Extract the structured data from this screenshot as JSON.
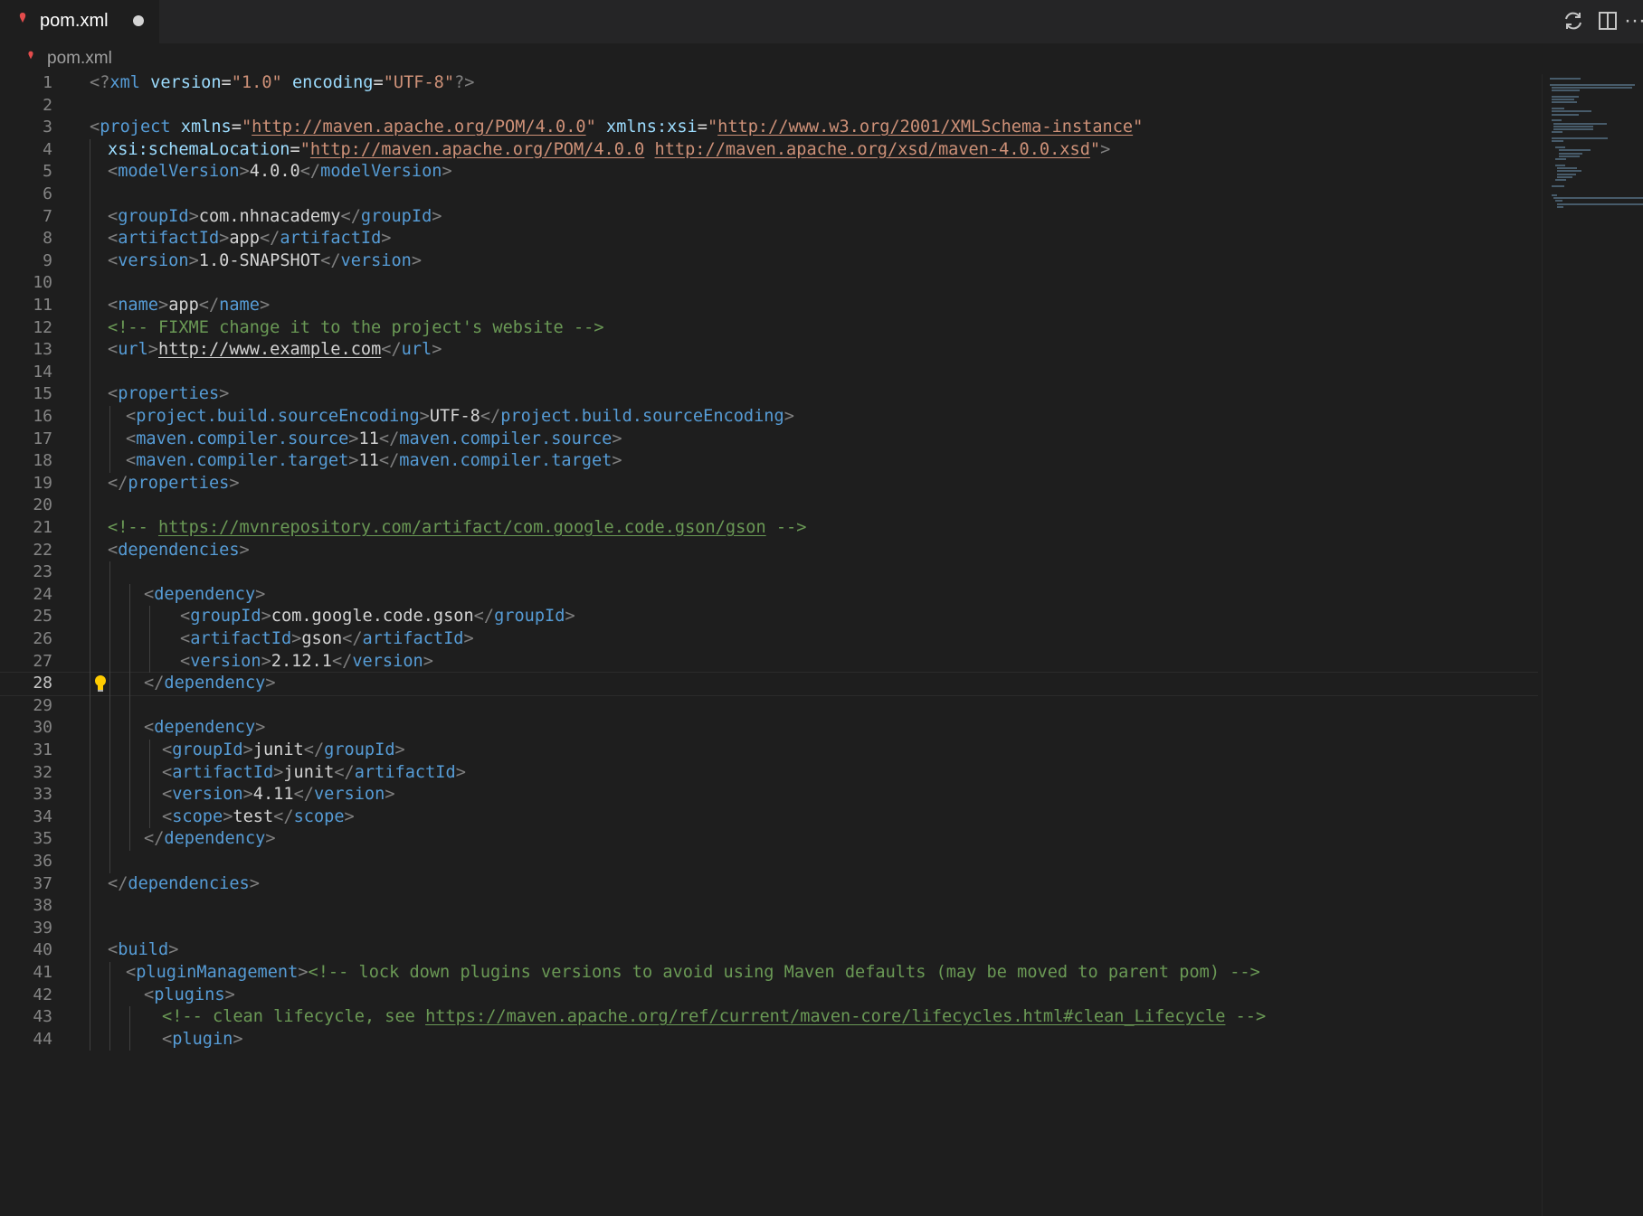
{
  "tab": {
    "title": "pom.xml",
    "dirty": true
  },
  "breadcrumb": {
    "label": "pom.xml"
  },
  "actions": [
    "sync-icon",
    "split-editor-icon",
    "more-actions-icon"
  ],
  "editor": {
    "active_line": 28,
    "line_numbers": [
      "1",
      "2",
      "3",
      "4",
      "5",
      "6",
      "7",
      "8",
      "9",
      "10",
      "11",
      "12",
      "13",
      "14",
      "15",
      "16",
      "17",
      "18",
      "19",
      "20",
      "21",
      "22",
      "23",
      "24",
      "25",
      "26",
      "27",
      "28",
      "29",
      "30",
      "31",
      "32",
      "33",
      "34",
      "35",
      "36",
      "37",
      "38",
      "39",
      "40",
      "41",
      "42",
      "43",
      "44"
    ],
    "lines": [
      {
        "indent": 0,
        "tokens": [
          [
            "t",
            "<?"
          ],
          [
            "n",
            "xml "
          ],
          [
            "a",
            "version"
          ],
          [
            "txt",
            "="
          ],
          [
            "s",
            "\"1.0\""
          ],
          [
            "txt",
            " "
          ],
          [
            "a",
            "encoding"
          ],
          [
            "txt",
            "="
          ],
          [
            "s",
            "\"UTF-8\""
          ],
          [
            "t",
            "?>"
          ]
        ]
      },
      {
        "indent": 0,
        "tokens": []
      },
      {
        "indent": 0,
        "tokens": [
          [
            "t",
            "<"
          ],
          [
            "n",
            "project"
          ],
          [
            "txt",
            " "
          ],
          [
            "a",
            "xmlns"
          ],
          [
            "txt",
            "="
          ],
          [
            "s",
            "\""
          ],
          [
            "su",
            "http://maven.apache.org/POM/4.0.0"
          ],
          [
            "s",
            "\""
          ],
          [
            "txt",
            " "
          ],
          [
            "a",
            "xmlns:xsi"
          ],
          [
            "txt",
            "="
          ],
          [
            "s",
            "\""
          ],
          [
            "su",
            "http://www.w3.org/2001/XMLSchema-instance"
          ],
          [
            "s",
            "\""
          ]
        ]
      },
      {
        "indent": 1,
        "tokens": [
          [
            "a",
            "xsi:schemaLocation"
          ],
          [
            "txt",
            "="
          ],
          [
            "s",
            "\""
          ],
          [
            "su",
            "http://maven.apache.org/POM/4.0.0"
          ],
          [
            "s",
            " "
          ],
          [
            "su",
            "http://maven.apache.org/xsd/maven-4.0.0.xsd"
          ],
          [
            "s",
            "\""
          ],
          [
            "t",
            ">"
          ]
        ]
      },
      {
        "indent": 1,
        "tokens": [
          [
            "t",
            "<"
          ],
          [
            "n",
            "modelVersion"
          ],
          [
            "t",
            ">"
          ],
          [
            "txt",
            "4.0.0"
          ],
          [
            "t",
            "</"
          ],
          [
            "n",
            "modelVersion"
          ],
          [
            "t",
            ">"
          ]
        ]
      },
      {
        "indent": 0,
        "tokens": []
      },
      {
        "indent": 1,
        "tokens": [
          [
            "t",
            "<"
          ],
          [
            "n",
            "groupId"
          ],
          [
            "t",
            ">"
          ],
          [
            "txt",
            "com.nhnacademy"
          ],
          [
            "t",
            "</"
          ],
          [
            "n",
            "groupId"
          ],
          [
            "t",
            ">"
          ]
        ]
      },
      {
        "indent": 1,
        "tokens": [
          [
            "t",
            "<"
          ],
          [
            "n",
            "artifactId"
          ],
          [
            "t",
            ">"
          ],
          [
            "txt",
            "app"
          ],
          [
            "t",
            "</"
          ],
          [
            "n",
            "artifactId"
          ],
          [
            "t",
            ">"
          ]
        ]
      },
      {
        "indent": 1,
        "tokens": [
          [
            "t",
            "<"
          ],
          [
            "n",
            "version"
          ],
          [
            "t",
            ">"
          ],
          [
            "txt",
            "1.0-SNAPSHOT"
          ],
          [
            "t",
            "</"
          ],
          [
            "n",
            "version"
          ],
          [
            "t",
            ">"
          ]
        ]
      },
      {
        "indent": 0,
        "tokens": []
      },
      {
        "indent": 1,
        "tokens": [
          [
            "t",
            "<"
          ],
          [
            "n",
            "name"
          ],
          [
            "t",
            ">"
          ],
          [
            "txt",
            "app"
          ],
          [
            "t",
            "</"
          ],
          [
            "n",
            "name"
          ],
          [
            "t",
            ">"
          ]
        ]
      },
      {
        "indent": 1,
        "tokens": [
          [
            "c",
            "<!-- FIXME change it to the project's website -->"
          ]
        ]
      },
      {
        "indent": 1,
        "tokens": [
          [
            "t",
            "<"
          ],
          [
            "n",
            "url"
          ],
          [
            "t",
            ">"
          ],
          [
            "txtu",
            "http://www.example.com"
          ],
          [
            "t",
            "</"
          ],
          [
            "n",
            "url"
          ],
          [
            "t",
            ">"
          ]
        ]
      },
      {
        "indent": 0,
        "tokens": []
      },
      {
        "indent": 1,
        "tokens": [
          [
            "t",
            "<"
          ],
          [
            "n",
            "properties"
          ],
          [
            "t",
            ">"
          ]
        ]
      },
      {
        "indent": 2,
        "tokens": [
          [
            "t",
            "<"
          ],
          [
            "n",
            "project.build.sourceEncoding"
          ],
          [
            "t",
            ">"
          ],
          [
            "txt",
            "UTF-8"
          ],
          [
            "t",
            "</"
          ],
          [
            "n",
            "project.build.sourceEncoding"
          ],
          [
            "t",
            ">"
          ]
        ]
      },
      {
        "indent": 2,
        "tokens": [
          [
            "t",
            "<"
          ],
          [
            "n",
            "maven.compiler.source"
          ],
          [
            "t",
            ">"
          ],
          [
            "txt",
            "11"
          ],
          [
            "t",
            "</"
          ],
          [
            "n",
            "maven.compiler.source"
          ],
          [
            "t",
            ">"
          ]
        ]
      },
      {
        "indent": 2,
        "tokens": [
          [
            "t",
            "<"
          ],
          [
            "n",
            "maven.compiler.target"
          ],
          [
            "t",
            ">"
          ],
          [
            "txt",
            "11"
          ],
          [
            "t",
            "</"
          ],
          [
            "n",
            "maven.compiler.target"
          ],
          [
            "t",
            ">"
          ]
        ]
      },
      {
        "indent": 1,
        "tokens": [
          [
            "t",
            "</"
          ],
          [
            "n",
            "properties"
          ],
          [
            "t",
            ">"
          ]
        ]
      },
      {
        "indent": 0,
        "tokens": []
      },
      {
        "indent": 1,
        "tokens": [
          [
            "c",
            "<!-- "
          ],
          [
            "cu",
            "https://mvnrepository.com/artifact/com.google.code.gson/gson"
          ],
          [
            "c",
            " -->"
          ]
        ]
      },
      {
        "indent": 1,
        "tokens": [
          [
            "t",
            "<"
          ],
          [
            "n",
            "dependencies"
          ],
          [
            "t",
            ">"
          ]
        ]
      },
      {
        "indent": 0,
        "tokens": []
      },
      {
        "indent": 3,
        "tokens": [
          [
            "t",
            "<"
          ],
          [
            "n",
            "dependency"
          ],
          [
            "t",
            ">"
          ]
        ]
      },
      {
        "indent": 5,
        "tokens": [
          [
            "t",
            "<"
          ],
          [
            "n",
            "groupId"
          ],
          [
            "t",
            ">"
          ],
          [
            "txt",
            "com.google.code.gson"
          ],
          [
            "t",
            "</"
          ],
          [
            "n",
            "groupId"
          ],
          [
            "t",
            ">"
          ]
        ]
      },
      {
        "indent": 5,
        "tokens": [
          [
            "t",
            "<"
          ],
          [
            "n",
            "artifactId"
          ],
          [
            "t",
            ">"
          ],
          [
            "txt",
            "gson"
          ],
          [
            "t",
            "</"
          ],
          [
            "n",
            "artifactId"
          ],
          [
            "t",
            ">"
          ]
        ]
      },
      {
        "indent": 5,
        "tokens": [
          [
            "t",
            "<"
          ],
          [
            "n",
            "version"
          ],
          [
            "t",
            ">"
          ],
          [
            "txt",
            "2.12.1"
          ],
          [
            "t",
            "</"
          ],
          [
            "n",
            "version"
          ],
          [
            "t",
            ">"
          ]
        ]
      },
      {
        "indent": 3,
        "tokens": [
          [
            "t",
            "</"
          ],
          [
            "n",
            "dependency"
          ],
          [
            "t",
            ">"
          ]
        ]
      },
      {
        "indent": 0,
        "tokens": []
      },
      {
        "indent": 3,
        "tokens": [
          [
            "t",
            "<"
          ],
          [
            "n",
            "dependency"
          ],
          [
            "t",
            ">"
          ]
        ]
      },
      {
        "indent": 4,
        "tokens": [
          [
            "t",
            "<"
          ],
          [
            "n",
            "groupId"
          ],
          [
            "t",
            ">"
          ],
          [
            "txt",
            "junit"
          ],
          [
            "t",
            "</"
          ],
          [
            "n",
            "groupId"
          ],
          [
            "t",
            ">"
          ]
        ]
      },
      {
        "indent": 4,
        "tokens": [
          [
            "t",
            "<"
          ],
          [
            "n",
            "artifactId"
          ],
          [
            "t",
            ">"
          ],
          [
            "txt",
            "junit"
          ],
          [
            "t",
            "</"
          ],
          [
            "n",
            "artifactId"
          ],
          [
            "t",
            ">"
          ]
        ]
      },
      {
        "indent": 4,
        "tokens": [
          [
            "t",
            "<"
          ],
          [
            "n",
            "version"
          ],
          [
            "t",
            ">"
          ],
          [
            "txt",
            "4.11"
          ],
          [
            "t",
            "</"
          ],
          [
            "n",
            "version"
          ],
          [
            "t",
            ">"
          ]
        ]
      },
      {
        "indent": 4,
        "tokens": [
          [
            "t",
            "<"
          ],
          [
            "n",
            "scope"
          ],
          [
            "t",
            ">"
          ],
          [
            "txt",
            "test"
          ],
          [
            "t",
            "</"
          ],
          [
            "n",
            "scope"
          ],
          [
            "t",
            ">"
          ]
        ]
      },
      {
        "indent": 3,
        "tokens": [
          [
            "t",
            "</"
          ],
          [
            "n",
            "dependency"
          ],
          [
            "t",
            ">"
          ]
        ]
      },
      {
        "indent": 0,
        "tokens": []
      },
      {
        "indent": 1,
        "tokens": [
          [
            "t",
            "</"
          ],
          [
            "n",
            "dependencies"
          ],
          [
            "t",
            ">"
          ]
        ]
      },
      {
        "indent": 0,
        "tokens": []
      },
      {
        "indent": 0,
        "tokens": []
      },
      {
        "indent": 1,
        "tokens": [
          [
            "t",
            "<"
          ],
          [
            "n",
            "build"
          ],
          [
            "t",
            ">"
          ]
        ]
      },
      {
        "indent": 2,
        "tokens": [
          [
            "t",
            "<"
          ],
          [
            "n",
            "pluginManagement"
          ],
          [
            "t",
            ">"
          ],
          [
            "c",
            "<!-- lock down plugins versions to avoid using Maven defaults (may be moved to parent pom) -->"
          ]
        ]
      },
      {
        "indent": 3,
        "tokens": [
          [
            "t",
            "<"
          ],
          [
            "n",
            "plugins"
          ],
          [
            "t",
            ">"
          ]
        ]
      },
      {
        "indent": 4,
        "tokens": [
          [
            "c",
            "<!-- clean lifecycle, see "
          ],
          [
            "cu",
            "https://maven.apache.org/ref/current/maven-core/lifecycles.html#clean_Lifecycle"
          ],
          [
            "c",
            " -->"
          ]
        ]
      },
      {
        "indent": 4,
        "tokens": [
          [
            "t",
            "<"
          ],
          [
            "n",
            "plugin"
          ],
          [
            "t",
            ">"
          ]
        ]
      }
    ]
  },
  "colors": {
    "background": "#1e1e1e",
    "tag": "#569cd6",
    "attribute": "#9cdcfe",
    "string": "#ce9178",
    "comment": "#6a9955",
    "bracket": "#808080",
    "text": "#d4d4d4",
    "xml_icon": "#e34c4c",
    "lightbulb": "#ffcc00"
  }
}
